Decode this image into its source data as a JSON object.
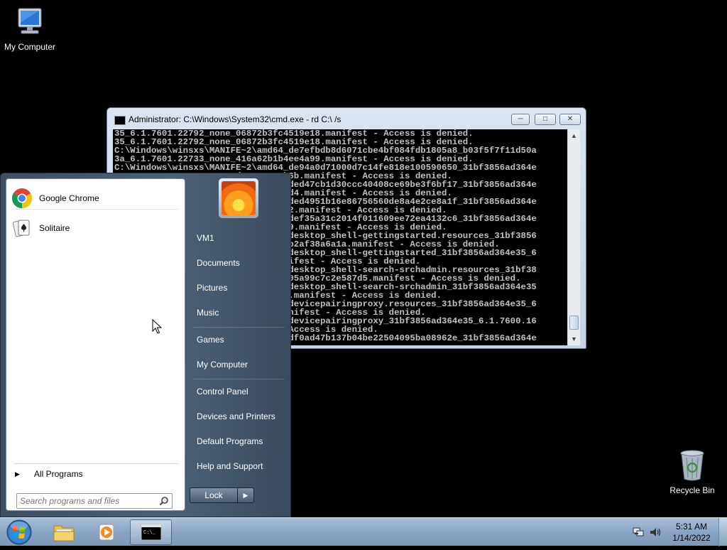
{
  "desktop": {
    "icons": [
      {
        "label": "My Computer"
      },
      {
        "label": "Recycle Bin"
      }
    ]
  },
  "cmd_window": {
    "title": "Administrator: C:\\Windows\\System32\\cmd.exe - rd  C:\\ /s",
    "lines": [
      "35_6.1.7601.22792_none_06872b3fc4519e18.manifest - Access is denied.",
      "35_6.1.7601.22792_none_06872b3fc4519e18.manifest - Access is denied.",
      "C:\\Windows\\winsxs\\MANIFE~2\\amd64_de7efbdb8d6071cbe4bf084fdb1805a8_b03f5f7f11d50a",
      "3a_6.1.7601.22733_none_416a62b1b4ee4a99.manifest - Access is denied.",
      "C:\\Windows\\winsxs\\MANIFE~2\\amd64_de94a0d71000d7c14fe818e100590650_31bf3856ad364e",
      "35_6.1.7601.22792_none_d6c4a1560b6b.manifest - Access is denied.",
      "C:\\Windows\\winsxs\\MANIFE~2\\amd64_ded47cb1d30ccc40408ce69be3f6bf17_31bf3856ad364e",
      "35_6.1.7601.22792_none_08c7de5591d4.manifest - Access is denied.",
      "C:\\Windows\\winsxs\\MANIFE~2\\amd64_ded4951b16e86756560de8a4e2ce8a1f_31bf3856ad364e",
      "35_6.1.7601.22792_none_e1a8dde0492.manifest - Access is denied.",
      "C:\\Windows\\winsxs\\MANIFE~2\\amd64_def35a31c2014f011609ee72ea4132c6_31bf3856ad364e",
      "35_6.1.7601.22792_none_7a6e62eadc9.manifest - Access is denied.",
      "C:\\Windows\\winsxs\\MANIFE~2\\amd64_desktop_shell-gettingstarted.resources_31bf3856",
      "ad364e35_6.1.7600.16385_en-us_5b8b2af38a6a1a.manifest - Access is denied.",
      "C:\\Windows\\winsxs\\MANIFE~2\\amd64_desktop_shell-gettingstarted_31bf3856ad364e35_6",
      ".1.7601.22792_none_d1a4e0b7ed.manifest - Access is denied.",
      "C:\\Windows\\winsxs\\MANIFE~2\\amd64_desktop_shell-search-srchadmin.resources_31bf38",
      "56ad364e35_6.1.7600.16385_en-us_805a99c7c2e587d5.manifest - Access is denied.",
      "C:\\Windows\\winsxs\\MANIFE~2\\amd64_desktop_shell-search-srchadmin_31bf3856ad364e35",
      "_6.1.7601.22792_none_0b4e8d7a5b5c.manifest - Access is denied.",
      "C:\\Windows\\winsxs\\MANIFE~2\\amd64_devicepairingproxy.resources_31bf3856ad364e35_6",
      ".1.7600.16385_en-us_c1e3e73e49.manifest - Access is denied.",
      "C:\\Windows\\winsxs\\MANIFE~2\\amd64_devicepairingproxy_31bf3856ad364e35_6.1.7600.16",
      "385_none_7d8e1c0b5b92.manifest - Access is denied.",
      "C:\\Windows\\winsxs\\MANIFE~2\\amd64_df0ad47b137b04be22504095ba08962e_31bf3856ad364e"
    ]
  },
  "start_menu": {
    "pinned": [
      {
        "label": "Google Chrome",
        "icon": "chrome-icon"
      },
      {
        "label": "Solitaire",
        "icon": "solitaire-icon"
      }
    ],
    "all_programs": "All Programs",
    "search_placeholder": "Search programs and files",
    "right_items": [
      "VM1",
      "Documents",
      "Pictures",
      "Music",
      "Games",
      "My Computer",
      "Control Panel",
      "Devices and Printers",
      "Default Programs",
      "Help and Support"
    ],
    "lock_label": "Lock"
  },
  "taskbar": {
    "time": "5:31 AM",
    "date": "1/14/2022"
  },
  "colors": {
    "desktop_bg": "#000000",
    "taskbar": "#8aa5c4",
    "start_menu": "#4c6075"
  }
}
